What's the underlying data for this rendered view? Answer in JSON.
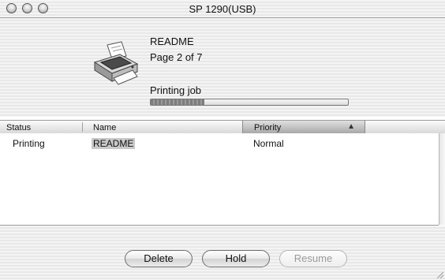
{
  "window": {
    "title": "SP 1290(USB)"
  },
  "job": {
    "document_name": "README",
    "page_info": "Page 2 of 7",
    "status_text": "Printing job",
    "progress_fraction": 0.27
  },
  "list": {
    "headers": {
      "status": "Status",
      "name": "Name",
      "priority": "Priority"
    },
    "sort_indicator": "▲",
    "rows": [
      {
        "status": "Printing",
        "name": "README",
        "priority": "Normal"
      }
    ]
  },
  "buttons": {
    "delete": "Delete",
    "hold": "Hold",
    "resume": "Resume"
  },
  "icons": {
    "printer": "printer-icon"
  }
}
